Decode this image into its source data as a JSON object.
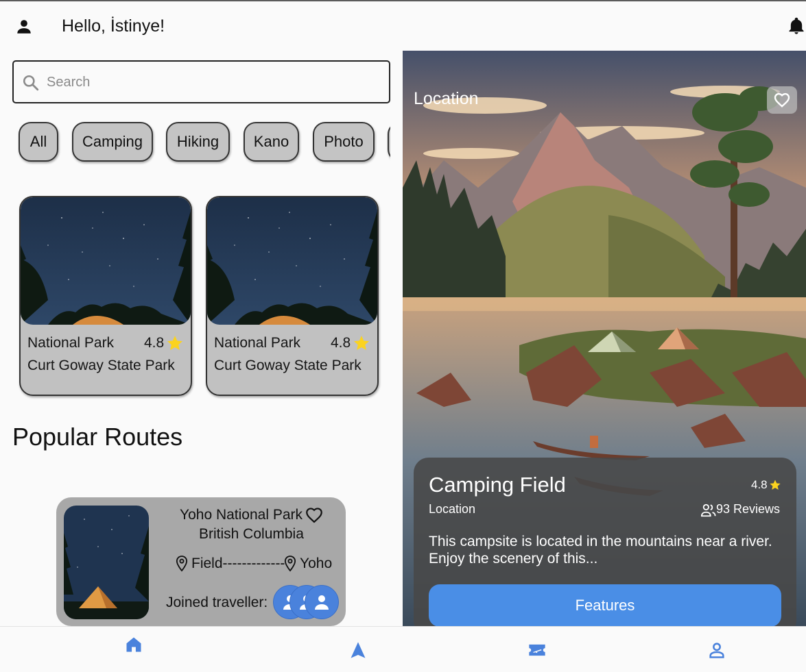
{
  "header": {
    "greeting": "Hello, İstinye!",
    "avatar_icon": "person-icon",
    "notification_icon": "bell-icon"
  },
  "search": {
    "placeholder": "Search",
    "value": "",
    "icon": "search-icon"
  },
  "categories": [
    "All",
    "Camping",
    "Hiking",
    "Kano",
    "Photo"
  ],
  "parks": [
    {
      "category": "National Park",
      "rating": "4.8",
      "name": "Curt Goway State Park"
    },
    {
      "category": "National Park",
      "rating": "4.8",
      "name": "Curt Goway State Park"
    }
  ],
  "popular": {
    "title": "Popular Routes",
    "route": {
      "name": "Yoho National Park",
      "region": "British Columbia",
      "from": "Field-------------",
      "to": "Yoho",
      "joined_label": "Joined traveller:"
    }
  },
  "detail": {
    "location_title": "Location",
    "title": "Camping Field",
    "rating": "4.8",
    "location": "Location",
    "reviews": "93 Reviews",
    "description": "This campsite is located in the mountains near a river. Enjoy the scenery of this...",
    "button": "Features"
  },
  "nav": {
    "items": [
      "home-icon",
      "navigation-arrow-icon",
      "flight-ticket-icon",
      "profile-icon"
    ],
    "active": 0
  },
  "colors": {
    "accent": "#4a8ee6",
    "nav_icon": "#4a82dc",
    "star": "#fbd31f",
    "chip_bg": "#c4c4c4",
    "card_bg": "#c1c1c1",
    "route_bg": "#a8a8a8"
  }
}
